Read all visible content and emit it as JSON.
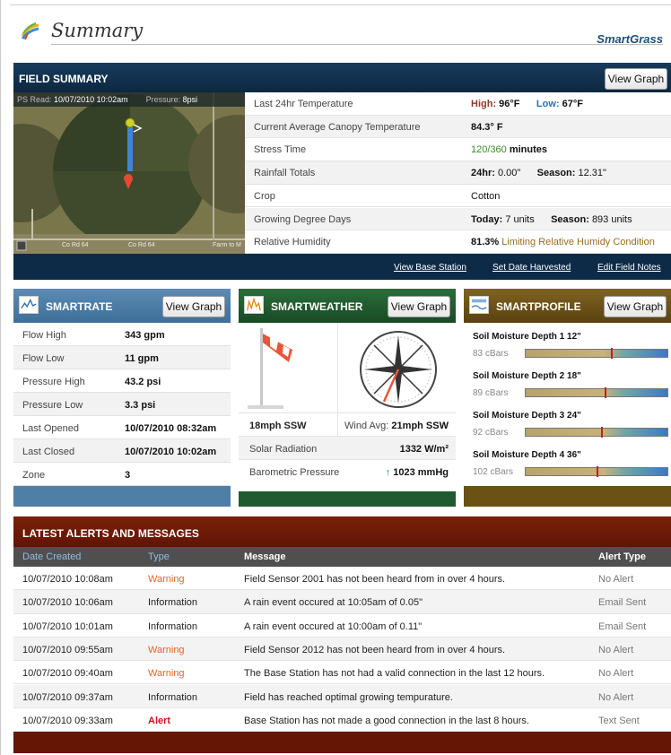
{
  "header": {
    "title": "Summary",
    "brand": "SmartGrass"
  },
  "field_summary": {
    "label": "FIELD SUMMARY",
    "view_graph": "View Graph",
    "map_status": {
      "ps_read_label": "PS Read:",
      "ps_read_value": "10/07/2010 10:02am",
      "pressure_label": "Pressure:",
      "pressure_value": "8psi"
    },
    "map_roads": [
      "Co Rd 64",
      "Co Rd 64",
      "Farm to M"
    ],
    "rows": [
      {
        "key": "Last 24hr Temperature",
        "high_label": "High:",
        "high_value": "96°F",
        "low_label": "Low:",
        "low_value": "67°F"
      },
      {
        "key": "Current Average Canopy Temperature",
        "value": "84.3° F"
      },
      {
        "key": "Stress Time",
        "value_green": "120/360",
        "value_suffix": "minutes"
      },
      {
        "key": "Rainfall Totals",
        "day_label": "24hr:",
        "day_value": "0.00\"",
        "season_label": "Season:",
        "season_value": "12.31\""
      },
      {
        "key": "Crop",
        "value": "Cotton"
      },
      {
        "key": "Growing Degree Days",
        "today_label": "Today:",
        "today_value": "7 units",
        "season_label": "Season:",
        "season_value": "893 units"
      },
      {
        "key": "Relative Humidity",
        "value_bold": "81.3%",
        "value_note": "Limiting Relative Humidy Condition"
      }
    ],
    "links": [
      "View Base Station",
      "Set Date Harvested",
      "Edit Field Notes"
    ]
  },
  "smartrate": {
    "title": "SMARTRATE",
    "view_graph": "View Graph",
    "rows": [
      {
        "key": "Flow High",
        "value": "343 gpm"
      },
      {
        "key": "Flow Low",
        "value": "11 gpm"
      },
      {
        "key": "Pressure High",
        "value": "43.2 psi"
      },
      {
        "key": "Pressure Low",
        "value": "3.3 psi"
      },
      {
        "key": "Last Opened",
        "value": "10/07/2010 08:32am"
      },
      {
        "key": "Last Closed",
        "value": "10/07/2010 10:02am"
      },
      {
        "key": "Zone",
        "value": "3"
      }
    ]
  },
  "smartweather": {
    "title": "SMARTWEATHER",
    "view_graph": "View Graph",
    "wind_speed": "18mph SSW",
    "wind_avg_label": "Wind Avg:",
    "wind_avg_value": "21mph SSW",
    "rows": [
      {
        "key": "Solar Radiation",
        "value": "1332 W/m²"
      },
      {
        "key": "Barometric Pressure",
        "value": "1023 mmHg",
        "trend": "up"
      }
    ]
  },
  "smartprofile": {
    "title": "SMARTPROFILE",
    "view_graph": "View Graph",
    "depths": [
      {
        "label": "Soil Moisture Depth 1 12\"",
        "value": "83 cBars",
        "level": 0.6
      },
      {
        "label": "Soil Moisture Depth 2 18\"",
        "value": "89 cBars",
        "level": 0.56
      },
      {
        "label": "Soil Moisture Depth 3 24\"",
        "value": "92 cBars",
        "level": 0.53
      },
      {
        "label": "Soil Moisture Depth 4 36\"",
        "value": "102 cBars",
        "level": 0.5
      }
    ]
  },
  "alerts": {
    "label": "LATEST ALERTS AND MESSAGES",
    "columns": [
      "Date Created",
      "Type",
      "Message",
      "Alert Type"
    ],
    "rows": [
      {
        "date": "10/07/2010 10:08am",
        "type": "Warning",
        "message": "Field Sensor 2001 has not been heard from in over 4 hours.",
        "alert_type": "No Alert"
      },
      {
        "date": "10/07/2010 10:06am",
        "type": "Information",
        "message": "A rain event occured at 10:05am of 0.05\"",
        "alert_type": "Email Sent"
      },
      {
        "date": "10/07/2010 10:01am",
        "type": "Information",
        "message": "A rain event occured at 10:00am of 0.11\"",
        "alert_type": "Email Sent"
      },
      {
        "date": "10/07/2010 09:55am",
        "type": "Warning",
        "message": "Field Sensor 2012 has not been heard from in over 4 hours.",
        "alert_type": "No Alert"
      },
      {
        "date": "10/07/2010 09:40am",
        "type": "Warning",
        "message": "The Base Station has not had a valid connection in the last 12 hours.",
        "alert_type": "No Alert"
      },
      {
        "date": "10/07/2010 09:37am",
        "type": "Information",
        "message": "Field has reached optimal growing tempurature.",
        "alert_type": "No Alert"
      },
      {
        "date": "10/07/2010 09:33am",
        "type": "Alert",
        "message": "Base Station has not made a good connection in the last 8 hours.",
        "alert_type": "Text Sent"
      }
    ]
  },
  "colors": {
    "field_summary": "#0d2b46",
    "smartrate": "#4f7fa6",
    "smartweather": "#205a2f",
    "smartprofile": "#6c5114",
    "alerts": "#651605",
    "warning": "#e0662a",
    "alert": "#d0121b"
  }
}
